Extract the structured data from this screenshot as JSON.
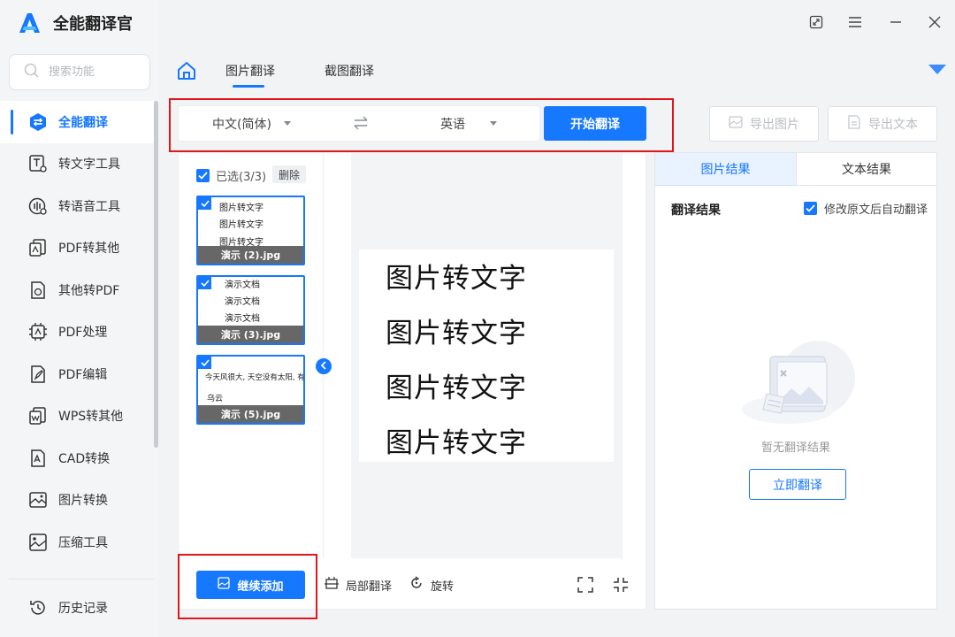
{
  "app": {
    "title": "全能翻译官"
  },
  "search": {
    "placeholder": "搜索功能"
  },
  "sidebar": {
    "items": [
      {
        "label": "全能翻译",
        "icon": "translate-icon",
        "active": true
      },
      {
        "label": "转文字工具",
        "icon": "text-tool-icon"
      },
      {
        "label": "转语音工具",
        "icon": "voice-tool-icon"
      },
      {
        "label": "PDF转其他",
        "icon": "pdf-convert-icon"
      },
      {
        "label": "其他转PDF",
        "icon": "to-pdf-icon"
      },
      {
        "label": "PDF处理",
        "icon": "pdf-process-icon"
      },
      {
        "label": "PDF编辑",
        "icon": "pdf-edit-icon"
      },
      {
        "label": "WPS转其他",
        "icon": "wps-convert-icon"
      },
      {
        "label": "CAD转换",
        "icon": "cad-icon"
      },
      {
        "label": "图片转换",
        "icon": "image-convert-icon"
      },
      {
        "label": "压缩工具",
        "icon": "compress-icon"
      }
    ],
    "history": "历史记录"
  },
  "tabs": {
    "image_translate": "图片翻译",
    "screenshot_translate": "截图翻译"
  },
  "lang": {
    "source": "中文(简体)",
    "target": "英语",
    "start": "开始翻译"
  },
  "export": {
    "image": "导出图片",
    "text": "导出文本"
  },
  "thumbs": {
    "selected": "已选(3/3)",
    "delete": "删除",
    "items": [
      {
        "lines": [
          "图片转文字",
          "图片转文字",
          "图片转文字"
        ],
        "caption": "演示 (2).jpg"
      },
      {
        "lines": [
          "演示文档",
          "演示文档",
          "演示文档"
        ],
        "caption": "演示 (3).jpg"
      },
      {
        "lines": [
          "今天风很大, 天空没有太阳, 有满一片",
          "乌云"
        ],
        "caption": "演示 (5).jpg"
      }
    ]
  },
  "preview": {
    "lines": [
      "图片转文字",
      "图片转文字",
      "图片转文字",
      "图片转文字"
    ]
  },
  "bottom": {
    "add": "继续添加",
    "partial": "局部翻译",
    "rotate": "旋转"
  },
  "result": {
    "tab_image": "图片结果",
    "tab_text": "文本结果",
    "title": "翻译结果",
    "auto": "修改原文后自动翻译",
    "empty": "暂无翻译结果",
    "now": "立即翻译"
  },
  "colors": {
    "accent": "#1677ff",
    "highlight": "#e0161b"
  }
}
